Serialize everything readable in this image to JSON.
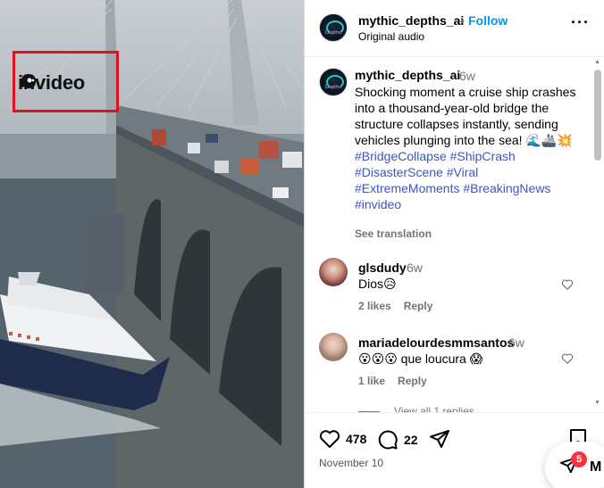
{
  "media": {
    "watermark": {
      "text": "invideo",
      "box_color": "#e0121b"
    }
  },
  "header": {
    "username": "mythic_depths_ai",
    "separator": "•",
    "follow_label": "Follow",
    "subtitle": "Original audio",
    "more_icon": "more-horizontal-icon",
    "avatar_text": "Depths"
  },
  "caption": {
    "username": "mythic_depths_ai",
    "time": "6w",
    "text": "Shocking moment a cruise ship crashes into a thousand-year-old bridge the structure collapses instantly, sending vehicles plunging into the sea! 🌊🚢💥",
    "hashtags": [
      "#BridgeCollapse",
      "#ShipCrash",
      "#DisasterScene",
      "#Viral",
      "#ExtremeMoments",
      "#BreakingNews",
      "#invideo"
    ],
    "see_translation": "See translation"
  },
  "comments": [
    {
      "username": "glsdudy",
      "time": "6w",
      "text": "Dios😥",
      "likes": "2 likes",
      "reply": "Reply"
    },
    {
      "username": "mariadelourdesmmsantos",
      "time": "6w",
      "text": "😮😮😮 que loucura 😱",
      "likes": "1 like",
      "reply": "Reply"
    }
  ],
  "view_replies": "View all 1 replies",
  "actions": {
    "likes_count": "478",
    "comments_count": "22",
    "date": "November 10"
  },
  "messages_fab": {
    "badge": "5",
    "label": "M"
  },
  "colors": {
    "accent": "#0095f6",
    "hashtag": "#3b56c6",
    "muted": "#737373",
    "badge": "#ff3040"
  }
}
